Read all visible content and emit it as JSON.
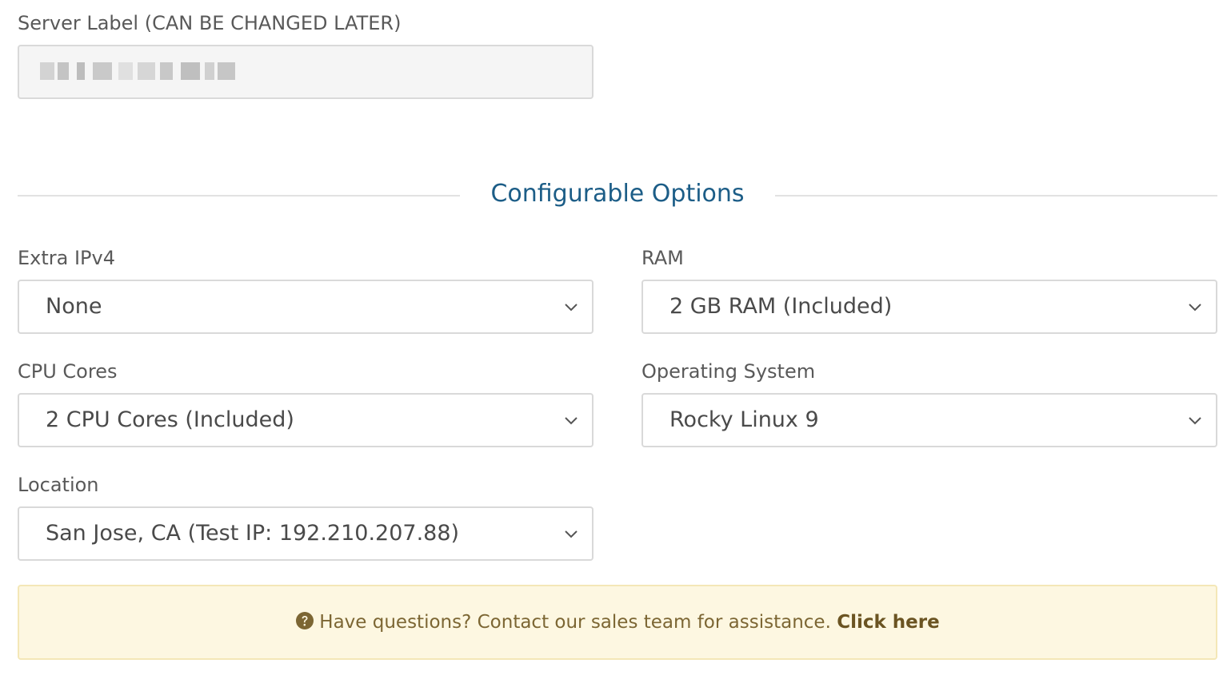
{
  "server_label": {
    "label": "Server Label (CAN BE CHANGED LATER)"
  },
  "section": {
    "title": "Configurable Options"
  },
  "options": {
    "extra_ipv4": {
      "label": "Extra IPv4",
      "value": "None"
    },
    "ram": {
      "label": "RAM",
      "value": "2 GB RAM (Included)"
    },
    "cpu": {
      "label": "CPU Cores",
      "value": "2 CPU Cores (Included)"
    },
    "os": {
      "label": "Operating System",
      "value": "Rocky Linux 9"
    },
    "location": {
      "label": "Location",
      "value": "San Jose, CA (Test IP: 192.210.207.88)"
    }
  },
  "notice": {
    "text": "Have questions? Contact our sales team for assistance.",
    "link": "Click here",
    "icon": "question-circle-icon"
  },
  "colors": {
    "section_title": "#1c5d87",
    "notice_bg": "#fdf7e1",
    "notice_text": "#7c6633"
  }
}
